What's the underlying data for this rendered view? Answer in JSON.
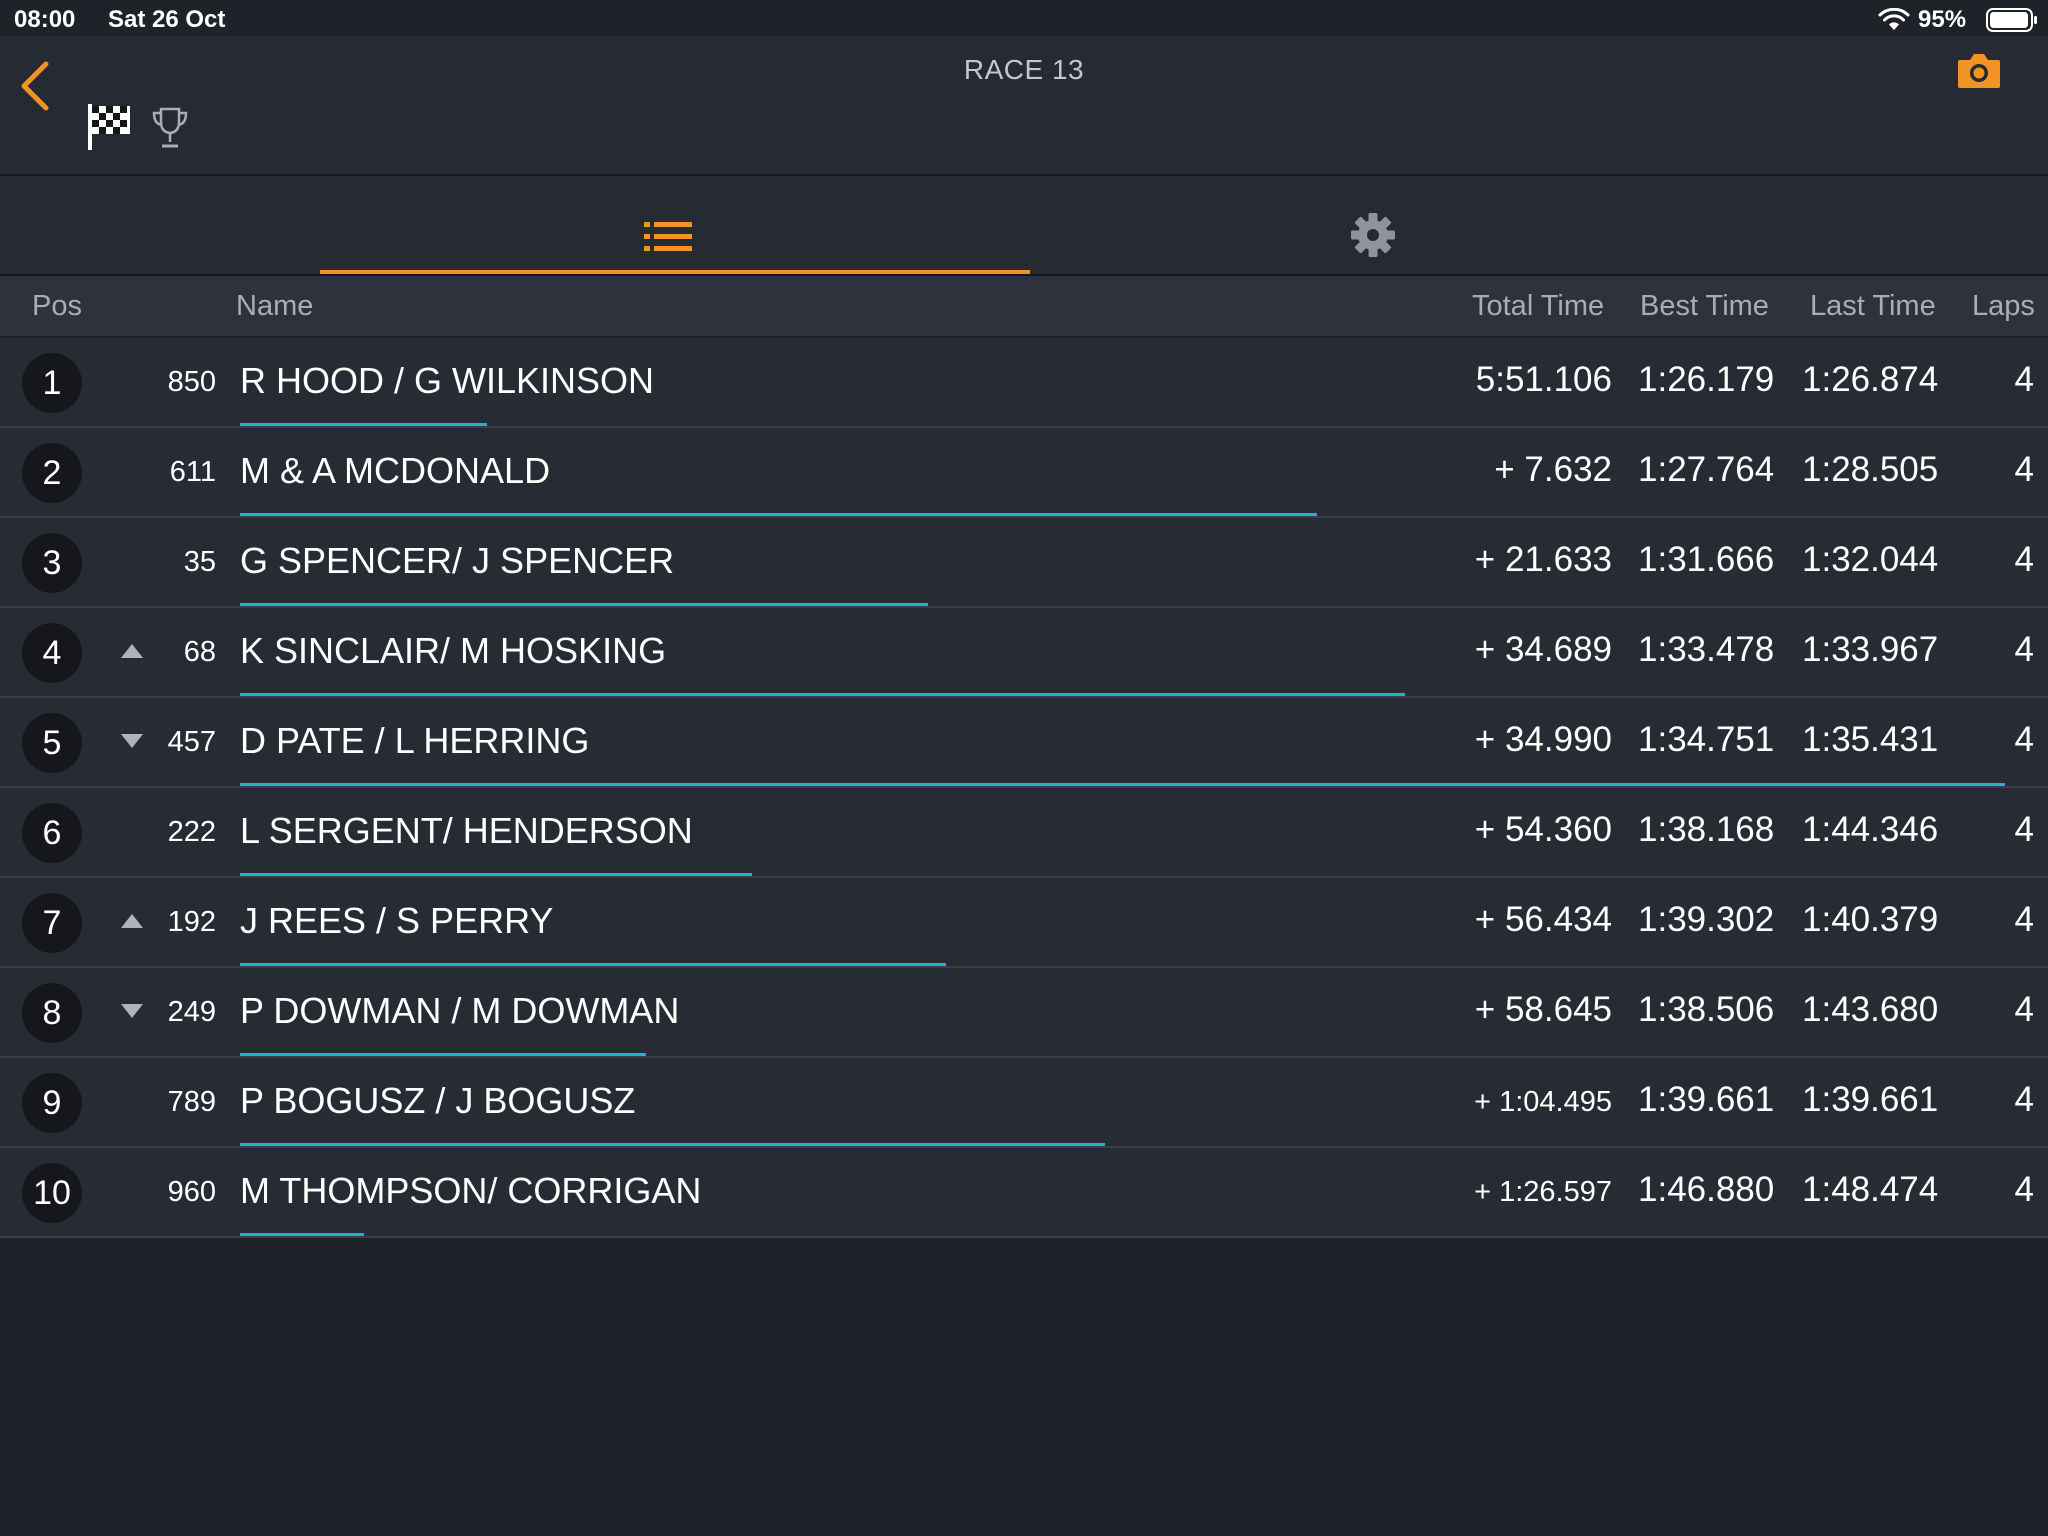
{
  "status": {
    "time": "08:00",
    "date": "Sat 26 Oct",
    "battery": "95%"
  },
  "nav": {
    "title": "RACE 13"
  },
  "colors": {
    "accent": "#f39323",
    "progress": "#1fb4c9",
    "background": "#1f2229",
    "header": "#262a33"
  },
  "tabs": [
    {
      "icon": "list-icon",
      "active": true
    },
    {
      "icon": "gear-icon",
      "active": false
    }
  ],
  "columns": {
    "pos": "Pos",
    "name": "Name",
    "total": "Total Time",
    "best": "Best Time",
    "last": "Last Time",
    "laps": "Laps"
  },
  "rows": [
    {
      "pos": "1",
      "change": "",
      "num": "850",
      "name": "R HOOD / G WILKINSON",
      "total": "5:51.106",
      "best": "1:26.179",
      "last": "1:26.874",
      "laps": "4",
      "progress": 0.14
    },
    {
      "pos": "2",
      "change": "",
      "num": "611",
      "name": "M & A MCDONALD",
      "total": "+ 7.632",
      "best": "1:27.764",
      "last": "1:28.505",
      "laps": "4",
      "progress": 0.61
    },
    {
      "pos": "3",
      "change": "",
      "num": "35",
      "name": "G SPENCER/ J SPENCER",
      "total": "+ 21.633",
      "best": "1:31.666",
      "last": "1:32.044",
      "laps": "4",
      "progress": 0.39
    },
    {
      "pos": "4",
      "change": "up",
      "num": "68",
      "name": "K SINCLAIR/ M HOSKING",
      "total": "+ 34.689",
      "best": "1:33.478",
      "last": "1:33.967",
      "laps": "4",
      "progress": 0.66
    },
    {
      "pos": "5",
      "change": "down",
      "num": "457",
      "name": "D PATE / L HERRING",
      "total": "+ 34.990",
      "best": "1:34.751",
      "last": "1:35.431",
      "laps": "4",
      "progress": 1.0
    },
    {
      "pos": "6",
      "change": "",
      "num": "222",
      "name": "L SERGENT/ HENDERSON",
      "total": "+ 54.360",
      "best": "1:38.168",
      "last": "1:44.346",
      "laps": "4",
      "progress": 0.29
    },
    {
      "pos": "7",
      "change": "up",
      "num": "192",
      "name": "J REES / S PERRY",
      "total": "+ 56.434",
      "best": "1:39.302",
      "last": "1:40.379",
      "laps": "4",
      "progress": 0.4
    },
    {
      "pos": "8",
      "change": "down",
      "num": "249",
      "name": "P DOWMAN / M DOWMAN",
      "total": "+ 58.645",
      "best": "1:38.506",
      "last": "1:43.680",
      "laps": "4",
      "progress": 0.23
    },
    {
      "pos": "9",
      "change": "",
      "num": "789",
      "name": "P BOGUSZ / J BOGUSZ",
      "total": "+ 1:04.495",
      "best": "1:39.661",
      "last": "1:39.661",
      "laps": "4",
      "progress": 0.49
    },
    {
      "pos": "10",
      "change": "",
      "num": "960",
      "name": "M THOMPSON/ CORRIGAN",
      "total": "+ 1:26.597",
      "best": "1:46.880",
      "last": "1:48.474",
      "laps": "4",
      "progress": 0.07
    }
  ]
}
